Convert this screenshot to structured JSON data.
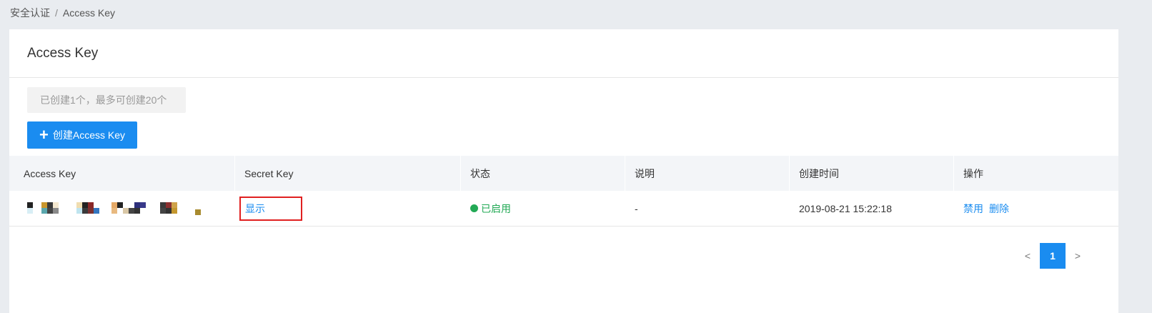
{
  "breadcrumb": {
    "parent": "安全认证",
    "separator": "/",
    "current": "Access Key"
  },
  "panel": {
    "title": "Access Key",
    "quota_notice": "已创建1个，最多可创建20个",
    "create_button": {
      "icon": "plus-icon",
      "label": "创建Access Key"
    }
  },
  "table": {
    "columns": [
      "Access Key",
      "Secret Key",
      "状态",
      "说明",
      "创建时间",
      "操作"
    ],
    "rows": [
      {
        "access_key_masked": true,
        "secret_key_action": "显示",
        "status": "已启用",
        "status_color": "#22a955",
        "description": "-",
        "created_at": "2019-08-21 15:22:18",
        "actions": [
          "禁用",
          "删除"
        ]
      }
    ]
  },
  "pagination": {
    "prev": "<",
    "current_page": "1",
    "next": ">"
  },
  "colors": {
    "accent": "#1a8cf0",
    "highlight_border": "#e02020"
  }
}
